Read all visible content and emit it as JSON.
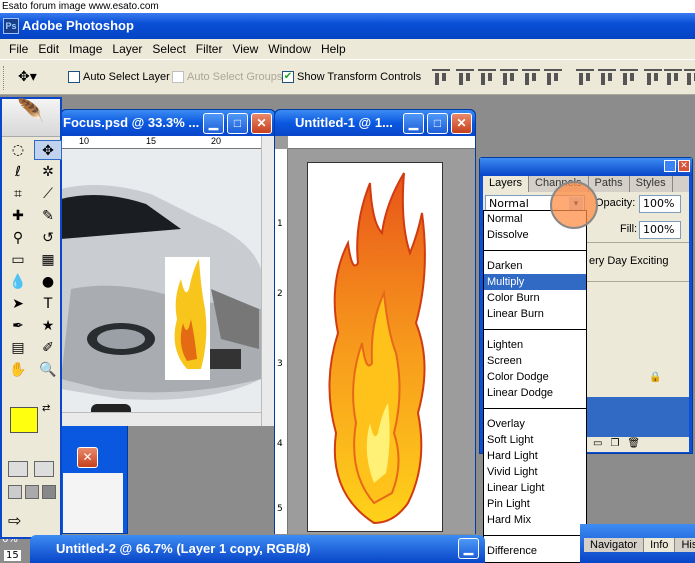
{
  "watermark": "Esato forum image www.esato.com",
  "app": {
    "title": "Adobe Photoshop"
  },
  "menu": [
    "File",
    "Edit",
    "Image",
    "Layer",
    "Select",
    "Filter",
    "View",
    "Window",
    "Help"
  ],
  "options_bar": {
    "auto_select_layer": {
      "label": "Auto Select Layer",
      "checked": false
    },
    "auto_select_groups": {
      "label": "Auto Select Groups",
      "checked": false,
      "disabled": true
    },
    "show_transform_controls": {
      "label": "Show Transform Controls",
      "checked": true
    }
  },
  "focus_window": {
    "title": "Focus.psd @ 33.3% ...",
    "ruler_ticks": [
      "10",
      "15",
      "20"
    ]
  },
  "untitled1_window": {
    "title": "Untitled-1 @ 1...",
    "ruler_ticks": [
      "1",
      "2",
      "3",
      "4",
      "5"
    ]
  },
  "layers_panel": {
    "tabs": [
      "Layers",
      "Channels",
      "Paths",
      "Styles"
    ],
    "active_tab": "Layers",
    "blend_mode": "Normal",
    "opacity_label": "Opacity:",
    "opacity_value": "100%",
    "fill_label": "Fill:",
    "fill_value": "100%",
    "visible_layer_text": "ery Day Exciting"
  },
  "blend_modes": {
    "groups": [
      [
        "Normal",
        "Dissolve"
      ],
      [
        "Darken",
        "Multiply",
        "Color Burn",
        "Linear Burn"
      ],
      [
        "Lighten",
        "Screen",
        "Color Dodge",
        "Linear Dodge"
      ],
      [
        "Overlay",
        "Soft Light",
        "Hard Light",
        "Vivid Light",
        "Linear Light",
        "Pin Light",
        "Hard Mix"
      ],
      [
        "Difference"
      ]
    ],
    "highlighted": "Multiply"
  },
  "untitled2_window": {
    "title": "Untitled-2 @ 66.7% (Layer 1 copy, RGB/8)"
  },
  "nav_panel": {
    "tabs": [
      "Navigator",
      "Info",
      "Hist"
    ],
    "active_tab": "Info"
  },
  "left_partial": {
    "zoom_text": "6%",
    "ruler_text": "15"
  },
  "colors": {
    "foreground": "#ffff10",
    "background": "#ffffff",
    "xp_blue": "#0a58e0",
    "highlight": "#316ac5"
  }
}
